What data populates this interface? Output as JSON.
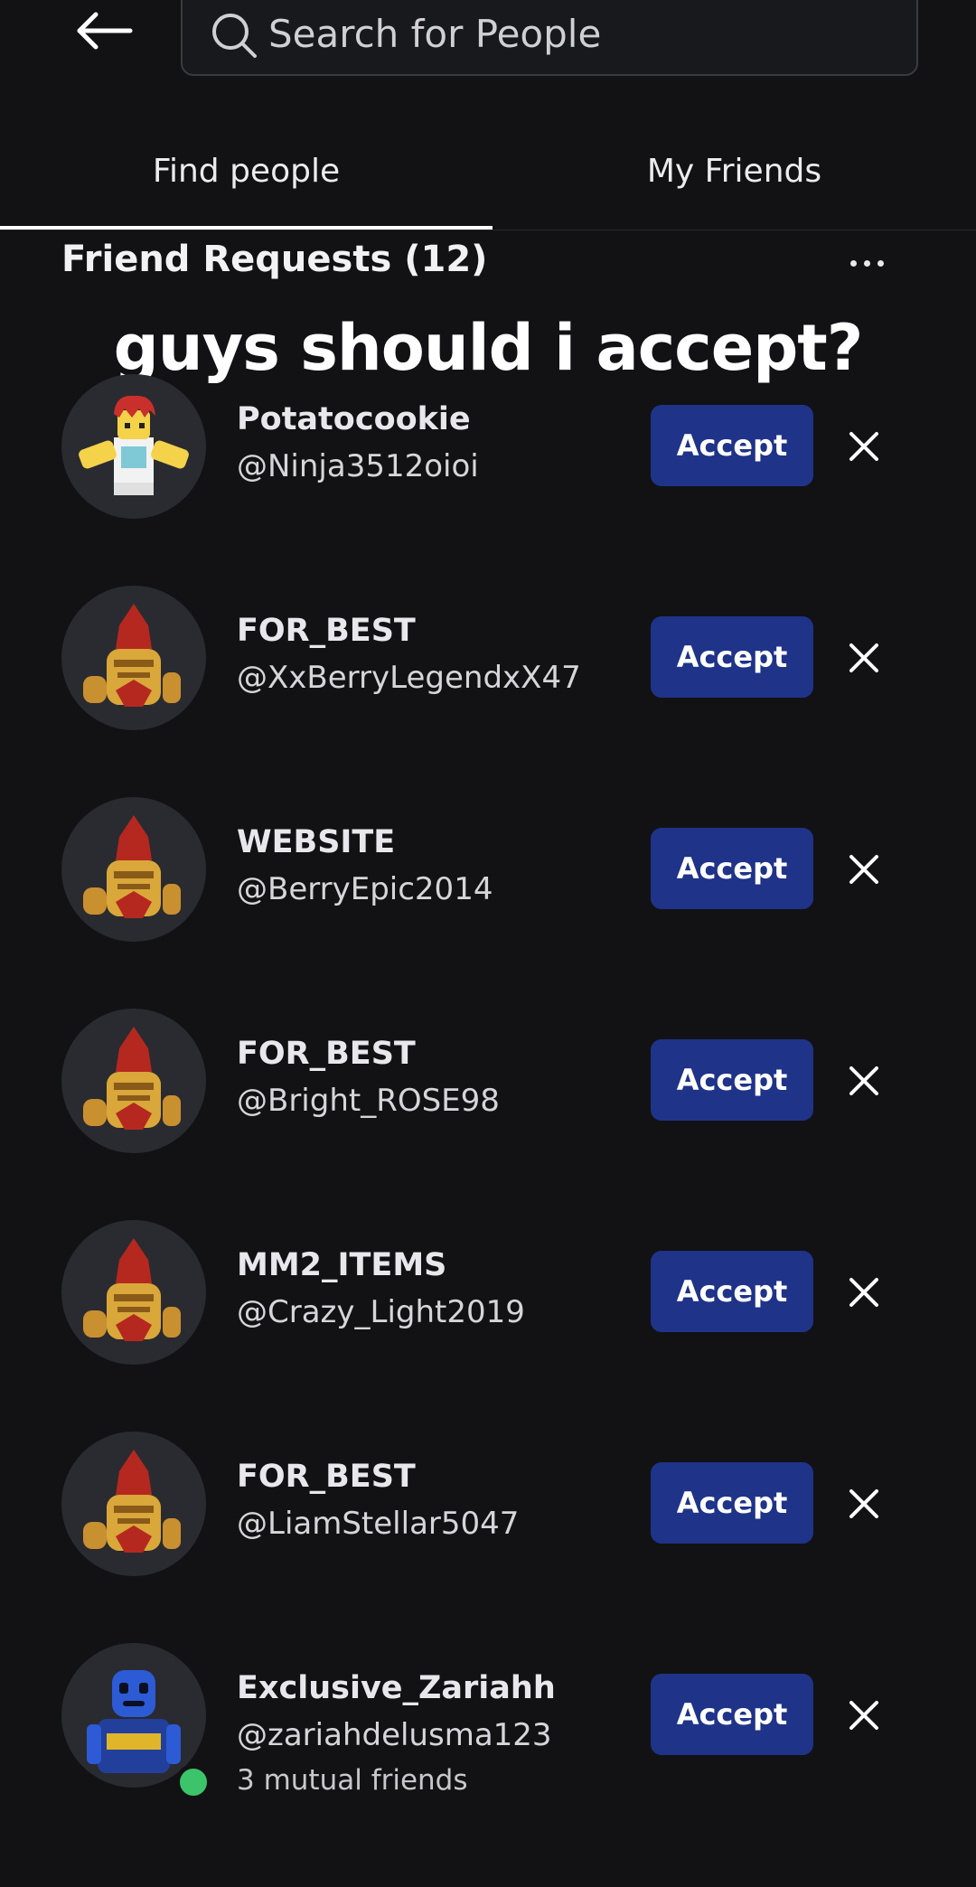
{
  "search": {
    "placeholder": "Search for People"
  },
  "tabs": [
    {
      "label": "Find people",
      "active": true
    },
    {
      "label": "My Friends",
      "active": false
    }
  ],
  "section": {
    "title": "Friend Requests (12)"
  },
  "caption": "guys should i accept?",
  "requests": [
    {
      "display_name": "Potatocookie",
      "username": "@Ninja3512oioi",
      "accept_label": "Accept",
      "avatar": "roblox-character-red-hair"
    },
    {
      "display_name": "FOR_BEST",
      "username": "@XxBerryLegendxX47",
      "accept_label": "Accept",
      "avatar": "knight-helmet"
    },
    {
      "display_name": "WEBSITE",
      "username": "@BerryEpic2014",
      "accept_label": "Accept",
      "avatar": "knight-helmet"
    },
    {
      "display_name": "FOR_BEST",
      "username": "@Bright_ROSE98",
      "accept_label": "Accept",
      "avatar": "knight-helmet"
    },
    {
      "display_name": "MM2_ITEMS",
      "username": "@Crazy_Light2019",
      "accept_label": "Accept",
      "avatar": "knight-helmet"
    },
    {
      "display_name": "FOR_BEST",
      "username": "@LiamStellar5047",
      "accept_label": "Accept",
      "avatar": "knight-helmet"
    },
    {
      "display_name": "Exclusive_Zariahh",
      "username": "@zariahdelusma123",
      "mutual": "3 mutual friends",
      "accept_label": "Accept",
      "avatar": "blue-robot",
      "online": true
    }
  ],
  "colors": {
    "background": "#121215",
    "accept_button": "#1f3389",
    "online_dot": "#3cc46a"
  }
}
